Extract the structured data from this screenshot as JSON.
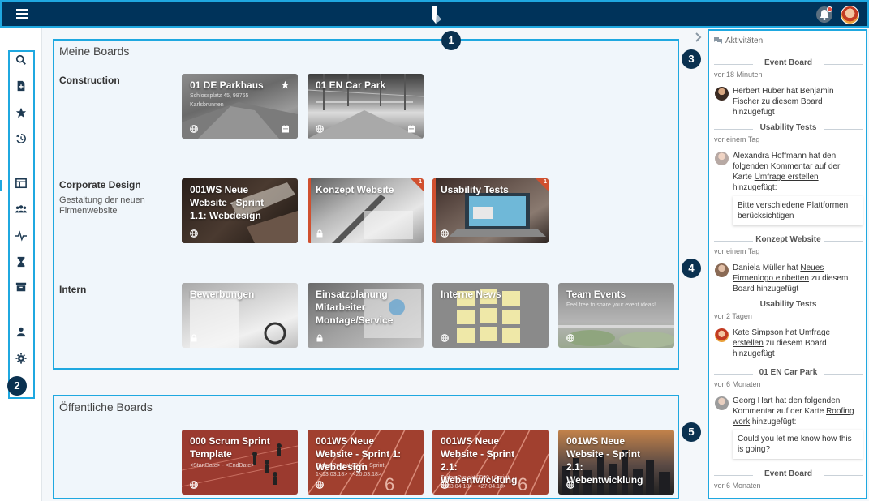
{
  "colors": {
    "topbar": "#00335a",
    "highlight": "#1fa8e0",
    "badge": "#d0502f"
  },
  "callouts": [
    "1",
    "2",
    "3",
    "4",
    "5"
  ],
  "my_boards": {
    "title": "Meine Boards",
    "groups": [
      {
        "name": "Construction",
        "description": "",
        "cards": [
          {
            "title": "01 DE Parkhaus",
            "subtitle": "Schlossplatz 45, 98765",
            "subtitle2": "Karlsbrunnen",
            "starred": true,
            "visibility": "globe-icon",
            "right_icon": "calendar-icon"
          },
          {
            "title": "01 EN Car Park",
            "subtitle": "",
            "subtitle2": "",
            "starred": false,
            "visibility": "globe-icon",
            "right_icon": "calendar-icon"
          }
        ]
      },
      {
        "name": "Corporate Design",
        "description": "Gestaltung der neuen Firmenwebsite",
        "cards": [
          {
            "title": "001WS Neue Website - Sprint 1.1: Webdesign",
            "badge": "",
            "visibility": "globe-icon"
          },
          {
            "title": "Konzept Website",
            "badge": "1",
            "visibility": "lock-icon"
          },
          {
            "title": "Usability Tests",
            "badge": "1",
            "visibility": "globe-icon"
          }
        ]
      },
      {
        "name": "Intern",
        "description": "",
        "cards": [
          {
            "title": "Bewerbungen",
            "subtitle": "",
            "visibility": "lock-icon"
          },
          {
            "title": "Einsatzplanung Mitarbeiter Montage/Service",
            "subtitle": "",
            "visibility": "lock-icon"
          },
          {
            "title": "Interne News",
            "subtitle": "",
            "visibility": "globe-icon"
          },
          {
            "title": "Team Events",
            "subtitle": "Feel free to share your event ideas!",
            "visibility": "globe-icon"
          }
        ]
      }
    ]
  },
  "public_boards": {
    "title": "Öffentliche Boards",
    "cards": [
      {
        "title": "000 Scrum Sprint Template",
        "subtitle": "<StartDate> - <EndDate>",
        "subtitle2": "",
        "visibility": "globe-icon"
      },
      {
        "title": "001WS Neue Website - Sprint 1: Webdesign",
        "subtitle": "Todos Projekt 0000 - Sprint",
        "subtitle2": "1<13.03.18> - <20.03.18>",
        "visibility": "globe-icon"
      },
      {
        "title": "001WS Neue Website - Sprint 2.1: Webentwicklung",
        "subtitle": "Todos Projekt 0000 - Sprint",
        "subtitle2": "2<23.04.18> - <27.04.18>",
        "visibility": "globe-icon"
      },
      {
        "title": "001WS Neue Website - Sprint 2.1: Webentwicklung",
        "subtitle": "",
        "subtitle2": "",
        "visibility": "globe-icon"
      }
    ]
  },
  "activities": {
    "title": "Aktivitäten",
    "items": [
      {
        "board": "Event Board",
        "time": "vor 18 Minuten",
        "text_parts": [
          "Herbert Huber hat Benjamin Fischer zu diesem Board hinzugefügt"
        ]
      },
      {
        "board": "Usability Tests",
        "time": "vor einem Tag",
        "text_pre": "Alexandra Hoffmann hat den folgenden Kommentar auf der Karte ",
        "link": "Umfrage erstellen",
        "text_post": " hinzugefügt:",
        "quote": "Bitte verschiedene Plattformen berücksichtigen"
      },
      {
        "board": "Konzept Website",
        "time": "vor einem Tag",
        "text_pre": "Daniela Müller hat ",
        "link": "Neues Firmenlogo einbetten",
        "text_post": " zu diesem Board hinzugefügt"
      },
      {
        "board": "Usability Tests",
        "time": "vor 2 Tagen",
        "text_pre": "Kate Simpson hat ",
        "link": "Umfrage erstellen",
        "text_post": " zu diesem Board hinzugefügt"
      },
      {
        "board": "01 EN Car Park",
        "time": "vor 6 Monaten",
        "text_pre": "Georg Hart hat den folgenden Kommentar auf der Karte ",
        "link": "Roofing work",
        "text_post": " hinzugefügt:",
        "quote": "Could you let me know how this is going?"
      },
      {
        "board": "Event Board",
        "time": "vor 6 Monaten"
      }
    ]
  }
}
